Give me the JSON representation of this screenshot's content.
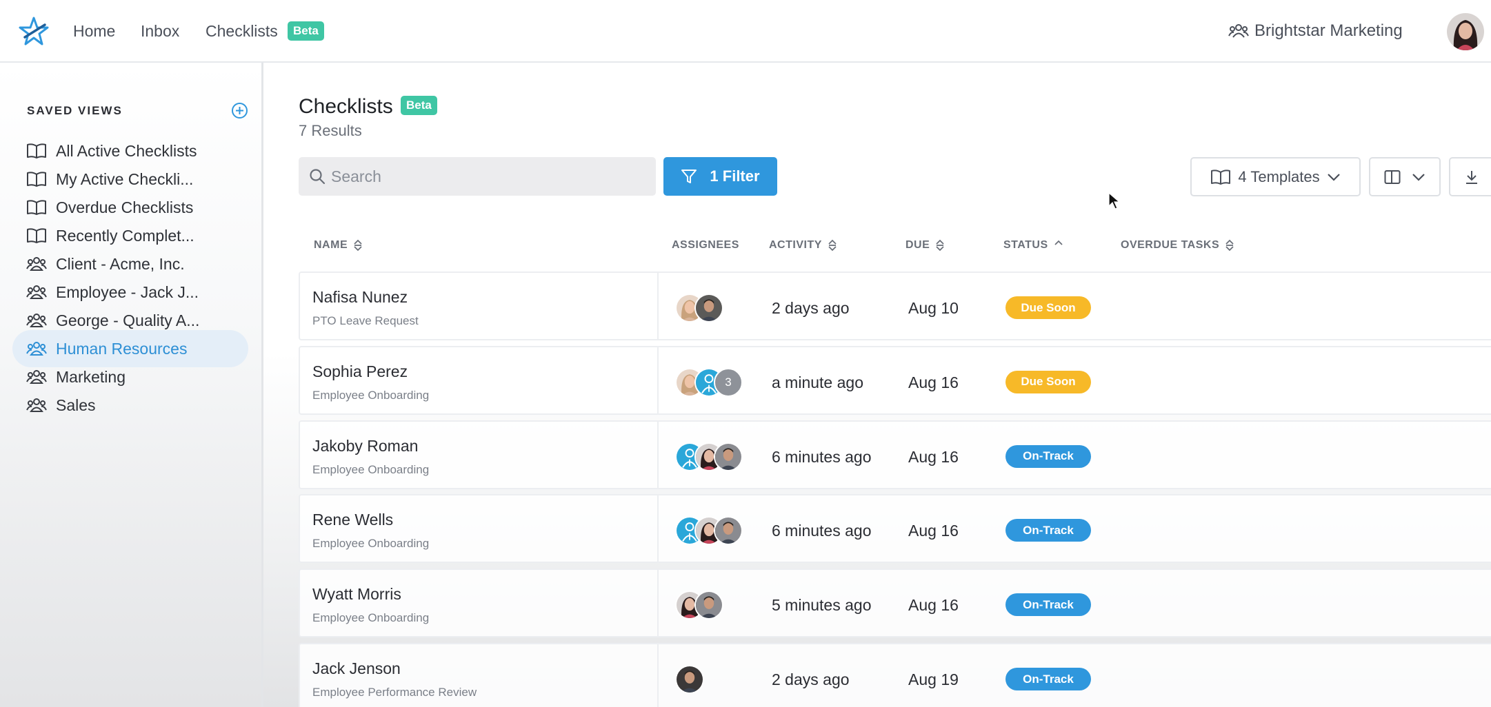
{
  "nav": {
    "home": "Home",
    "inbox": "Inbox",
    "checklists": "Checklists",
    "beta": "Beta",
    "org_name": "Brightstar Marketing"
  },
  "sidebar": {
    "title": "SAVED VIEWS",
    "items": [
      {
        "label": "All Active Checklists",
        "icon": "book-icon"
      },
      {
        "label": "My Active Checkli...",
        "icon": "book-icon"
      },
      {
        "label": "Overdue Checklists",
        "icon": "book-icon"
      },
      {
        "label": "Recently Complet...",
        "icon": "book-icon"
      },
      {
        "label": "Client - Acme, Inc.",
        "icon": "users-icon"
      },
      {
        "label": "Employee - Jack J...",
        "icon": "users-icon"
      },
      {
        "label": "George - Quality A...",
        "icon": "users-icon"
      },
      {
        "label": "Human Resources",
        "icon": "users-icon",
        "active": true
      },
      {
        "label": "Marketing",
        "icon": "users-icon"
      },
      {
        "label": "Sales",
        "icon": "users-icon"
      }
    ]
  },
  "main": {
    "title": "Checklists",
    "beta": "Beta",
    "results": "7 Results",
    "search_placeholder": "Search",
    "filter_label": "1 Filter",
    "templates_label": "4 Templates"
  },
  "table": {
    "headers": {
      "name": "NAME",
      "assignees": "ASSIGNEES",
      "activity": "ACTIVITY",
      "due": "DUE",
      "status": "STATUS",
      "overdue": "OVERDUE TASKS"
    },
    "rows": [
      {
        "name": "Nafisa Nunez",
        "template": "PTO Leave Request",
        "activity": "2 days ago",
        "due": "Aug 10",
        "status": "Due Soon",
        "extra_count": ""
      },
      {
        "name": "Sophia Perez",
        "template": "Employee Onboarding",
        "activity": "a minute ago",
        "due": "Aug 16",
        "status": "Due Soon",
        "extra_count": "3"
      },
      {
        "name": "Jakoby Roman",
        "template": "Employee Onboarding",
        "activity": "6 minutes ago",
        "due": "Aug 16",
        "status": "On-Track",
        "extra_count": ""
      },
      {
        "name": "Rene Wells",
        "template": "Employee Onboarding",
        "activity": "6 minutes ago",
        "due": "Aug 16",
        "status": "On-Track",
        "extra_count": ""
      },
      {
        "name": "Wyatt Morris",
        "template": "Employee Onboarding",
        "activity": "5 minutes ago",
        "due": "Aug 16",
        "status": "On-Track",
        "extra_count": ""
      },
      {
        "name": "Jack Jenson",
        "template": "Employee Performance Review",
        "activity": "2 days ago",
        "due": "Aug 19",
        "status": "On-Track",
        "extra_count": ""
      }
    ]
  },
  "colors": {
    "accent": "#2f97dd",
    "beta": "#3fc6a4",
    "due_soon": "#f7b928",
    "on_track": "#2f97dd"
  }
}
